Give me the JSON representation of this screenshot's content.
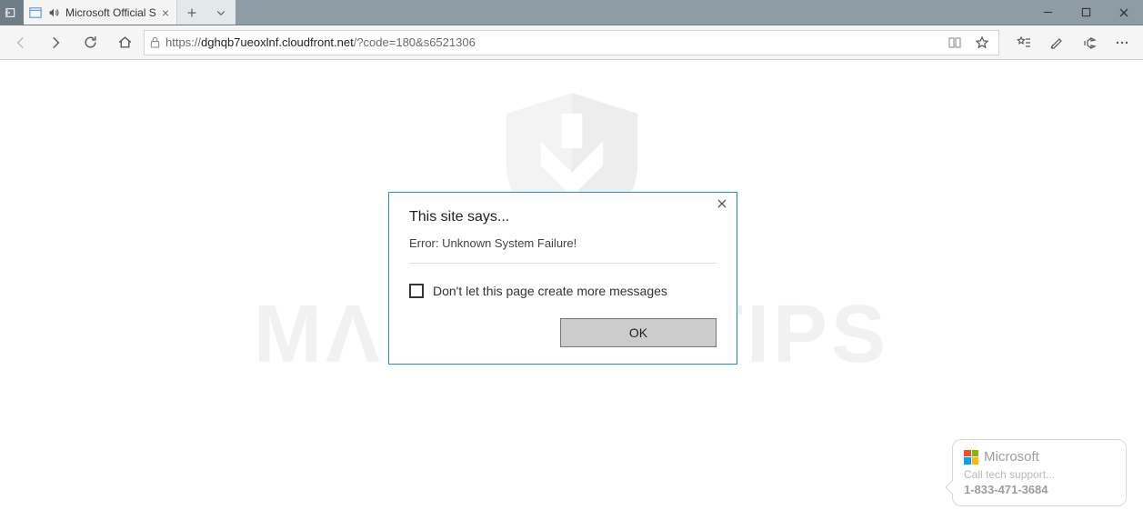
{
  "tabbar": {
    "tab_title": "Microsoft Official S"
  },
  "toolbar": {
    "url_prefix": "https://",
    "url_host": "dghqb7ueoxlnf.cloudfront.net",
    "url_path": "/?code=180&s6521306"
  },
  "dialog": {
    "title": "This site says...",
    "message": "Error: Unknown System Failure!",
    "checkbox_label": "Don't let this page create more messages",
    "ok_label": "OK"
  },
  "watermark": {
    "text": "MΛLWΛRETIPS"
  },
  "bubble": {
    "brand": "Microsoft",
    "line2": "Call tech support...",
    "phone": "1-833-471-3684"
  }
}
